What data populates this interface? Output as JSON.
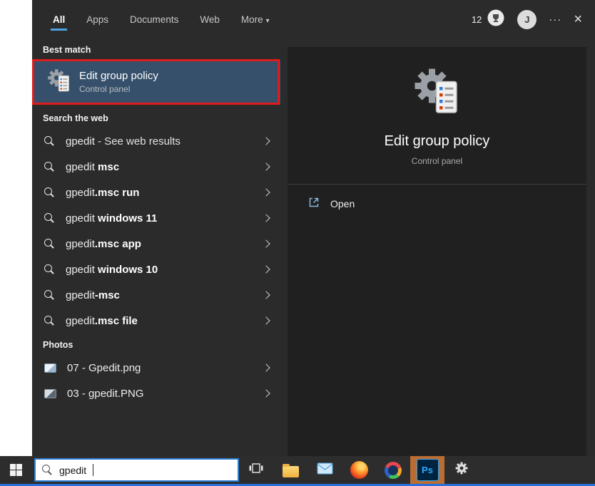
{
  "colors": {
    "tab_underline": "#4ba3e3",
    "selected_bg": "#36506b",
    "annotation_red": "#df1b1b",
    "search_border": "#2f80d4",
    "bottom_line": "#2a6fdb",
    "ps_bg": "#b96d33"
  },
  "tabs": {
    "items": [
      {
        "label": "All"
      },
      {
        "label": "Apps"
      },
      {
        "label": "Documents"
      },
      {
        "label": "Web"
      },
      {
        "label": "More"
      }
    ],
    "more_caret": "▾"
  },
  "top_right": {
    "rewards_count": "12",
    "avatar_initial": "J",
    "ellipsis": "···",
    "close": "×"
  },
  "best_match": {
    "header": "Best match",
    "title": "Edit group policy",
    "subtitle": "Control panel"
  },
  "search_web": {
    "header": "Search the web",
    "items": [
      {
        "q": "gpedit",
        "rest": " - See web results"
      },
      {
        "q": "gpedit ",
        "rest": "msc"
      },
      {
        "q": "gpedit",
        "rest": ".msc run"
      },
      {
        "q": "gpedit ",
        "rest": "windows 11"
      },
      {
        "q": "gpedit",
        "rest": ".msc app"
      },
      {
        "q": "gpedit ",
        "rest": "windows 10"
      },
      {
        "q": "gpedit",
        "rest": "-msc"
      },
      {
        "q": "gpedit",
        "rest": ".msc file"
      }
    ]
  },
  "photos": {
    "header": "Photos",
    "items": [
      {
        "name": "07 - Gpedit.png"
      },
      {
        "name": "03 - gpedit.PNG"
      }
    ]
  },
  "detail_panel": {
    "title": "Edit group policy",
    "subtitle": "Control panel",
    "open_label": "Open"
  },
  "taskbar": {
    "search_value": "gpedit",
    "ps_label": "Ps",
    "icons": [
      "windows-start",
      "task-view",
      "file-explorer",
      "mail",
      "firefox",
      "browser",
      "photoshop",
      "settings"
    ]
  }
}
